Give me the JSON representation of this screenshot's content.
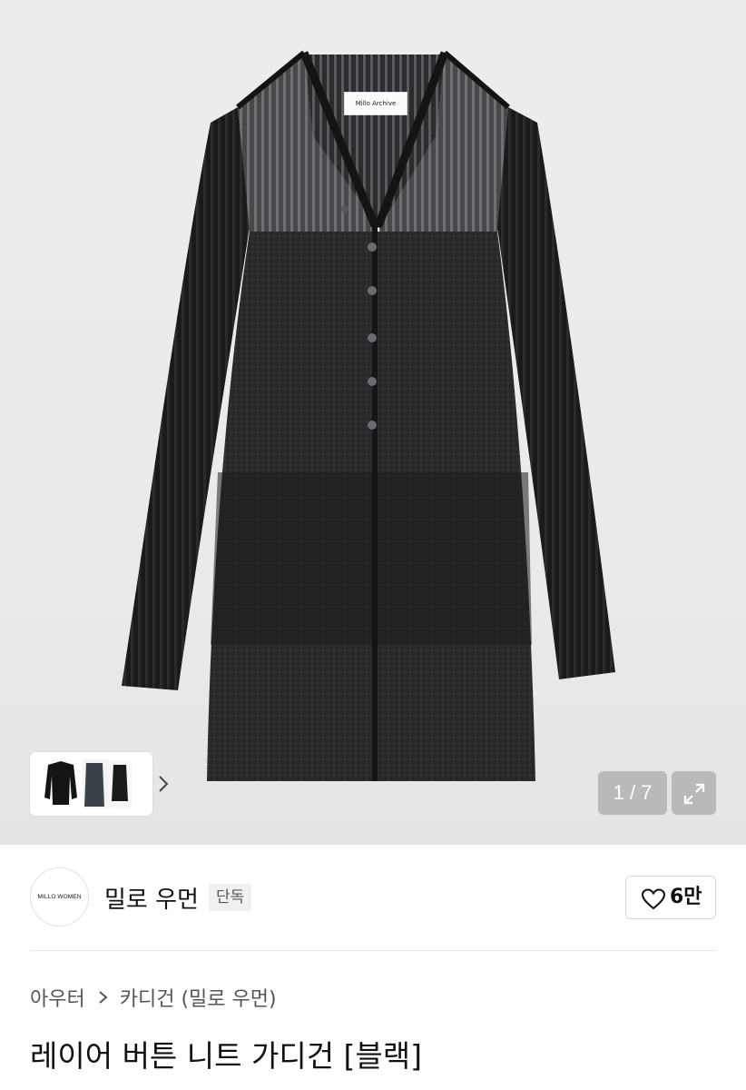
{
  "product_image": {
    "tag_label": "Millo Archive",
    "pager": "1 / 7",
    "thumbnail_count": 3
  },
  "brand": {
    "logo_text": "MILLO WOMEN",
    "name": "밀로 우먼",
    "badge": "단독",
    "likes": "6만"
  },
  "breadcrumb": {
    "category": "아우터",
    "subcategory": "카디건 (밀로 우먼)"
  },
  "product": {
    "title": "레이어 버튼 니트 가디건 [블랙]"
  },
  "icons": {
    "thumb_next": "chevron-right-icon",
    "expand": "expand-icon",
    "like": "heart-outline-icon",
    "breadcrumb_sep": "chevron-right-icon"
  },
  "colors": {
    "garment": "#1b1b1d",
    "background": "#ececec",
    "overlay": "#969696"
  }
}
